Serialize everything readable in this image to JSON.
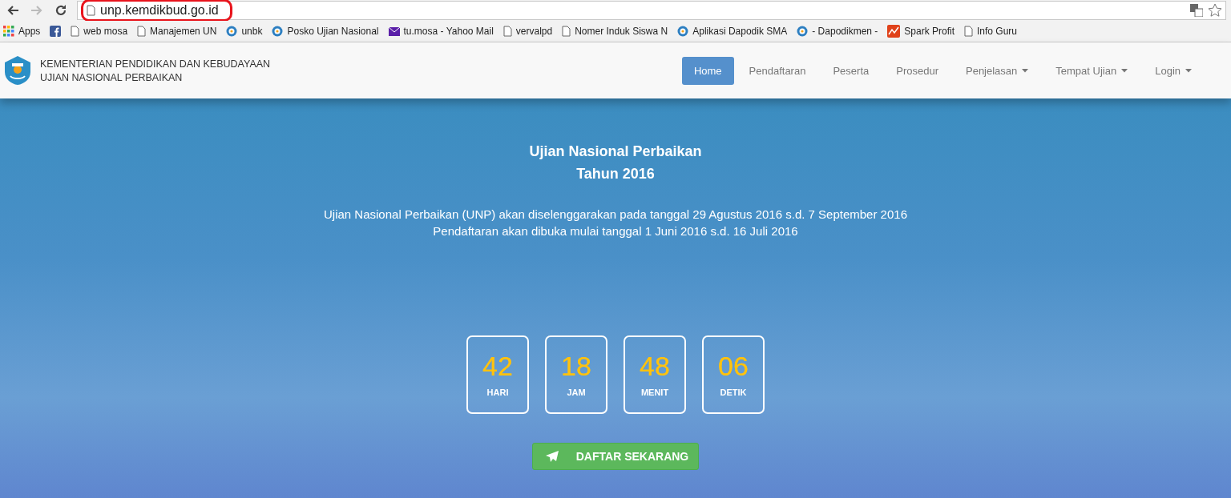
{
  "browser": {
    "url": "unp.kemdikbud.go.id",
    "url_highlighted": true,
    "bookmarks": [
      {
        "kind": "apps",
        "label": "Apps"
      },
      {
        "kind": "facebook"
      },
      {
        "kind": "page",
        "label": "web mosa"
      },
      {
        "kind": "page",
        "label": "Manajemen UN"
      },
      {
        "kind": "globe",
        "label": "unbk"
      },
      {
        "kind": "globe",
        "label": "Posko Ujian Nasional"
      },
      {
        "kind": "mail",
        "label": "tu.mosa - Yahoo Mail"
      },
      {
        "kind": "page",
        "label": "vervalpd"
      },
      {
        "kind": "page",
        "label": "Nomer Induk Siswa N"
      },
      {
        "kind": "globe",
        "label": "Aplikasi Dapodik SMA"
      },
      {
        "kind": "globe",
        "label": "- Dapodikmen -"
      },
      {
        "kind": "spark",
        "label": "Spark Profit"
      },
      {
        "kind": "page",
        "label": "Info Guru"
      }
    ]
  },
  "header": {
    "brand_lines": [
      "KEMENTERIAN PENDIDIKAN DAN KEBUDAYAAN",
      "UJIAN NASIONAL PERBAIKAN"
    ],
    "nav": [
      {
        "label": "Home",
        "selected": true,
        "dropdown": false
      },
      {
        "label": "Pendaftaran",
        "selected": false,
        "dropdown": false
      },
      {
        "label": "Peserta",
        "selected": false,
        "dropdown": false
      },
      {
        "label": "Prosedur",
        "selected": false,
        "dropdown": false
      },
      {
        "label": "Penjelasan",
        "selected": false,
        "dropdown": true
      },
      {
        "label": "Tempat Ujian",
        "selected": false,
        "dropdown": true
      },
      {
        "label": "Login",
        "selected": false,
        "dropdown": true
      }
    ]
  },
  "hero": {
    "title_lines": [
      "Ujian Nasional Perbaikan",
      "Tahun 2016"
    ],
    "description_lines": [
      "Ujian Nasional Perbaikan (UNP) akan diselenggarakan pada tanggal 29 Agustus 2016 s.d. 7 September 2016",
      "Pendaftaran akan dibuka mulai tanggal 1 Juni 2016 s.d. 16 Juli 2016"
    ],
    "countdown": [
      {
        "value": "42",
        "unit": "HARI"
      },
      {
        "value": "18",
        "unit": "JAM"
      },
      {
        "value": "48",
        "unit": "MENIT"
      },
      {
        "value": "06",
        "unit": "DETIK"
      }
    ],
    "cta": "DAFTAR SEKARANG"
  }
}
